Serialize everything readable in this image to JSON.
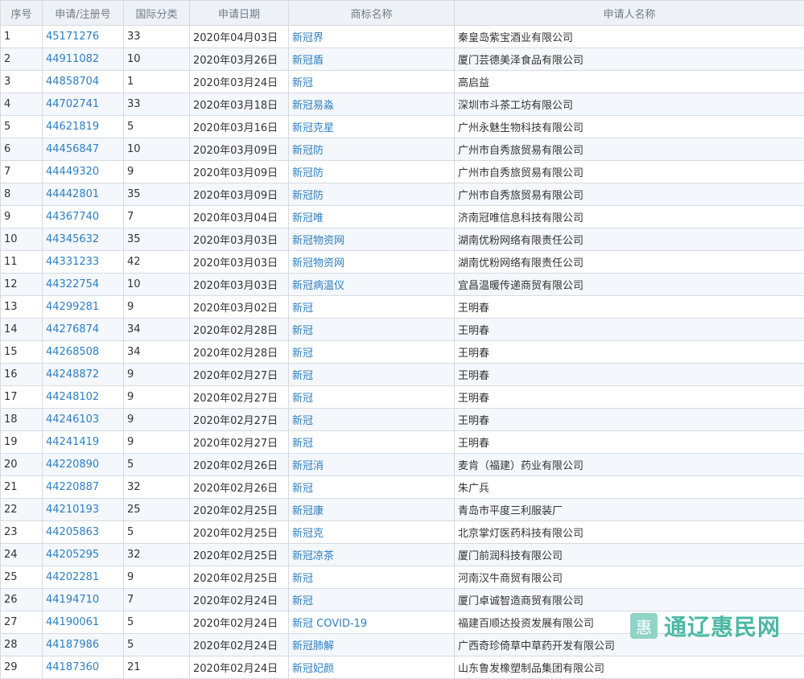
{
  "headers": [
    "序号",
    "申请/注册号",
    "国际分类",
    "申请日期",
    "商标名称",
    "申请人名称"
  ],
  "rows": [
    [
      "1",
      "45171276",
      "33",
      "2020年04月03日",
      "新冠界",
      "秦皇岛紫宝酒业有限公司"
    ],
    [
      "2",
      "44911082",
      "10",
      "2020年03月26日",
      "新冠盾",
      "厦门芸德美泽食品有限公司"
    ],
    [
      "3",
      "44858704",
      "1",
      "2020年03月24日",
      "新冠",
      "高启益"
    ],
    [
      "4",
      "44702741",
      "33",
      "2020年03月18日",
      "新冠易淼",
      "深圳市斗茶工坊有限公司"
    ],
    [
      "5",
      "44621819",
      "5",
      "2020年03月16日",
      "新冠克星",
      "广州永魅生物科技有限公司"
    ],
    [
      "6",
      "44456847",
      "10",
      "2020年03月09日",
      "新冠防",
      "广州市自秀旅贸易有限公司"
    ],
    [
      "7",
      "44449320",
      "9",
      "2020年03月09日",
      "新冠防",
      "广州市自秀旅贸易有限公司"
    ],
    [
      "8",
      "44442801",
      "35",
      "2020年03月09日",
      "新冠防",
      "广州市自秀旅贸易有限公司"
    ],
    [
      "9",
      "44367740",
      "7",
      "2020年03月04日",
      "新冠唯",
      "济南冠唯信息科技有限公司"
    ],
    [
      "10",
      "44345632",
      "35",
      "2020年03月03日",
      "新冠物资网",
      "湖南优粉网络有限责任公司"
    ],
    [
      "11",
      "44331233",
      "42",
      "2020年03月03日",
      "新冠物资网",
      "湖南优粉网络有限责任公司"
    ],
    [
      "12",
      "44322754",
      "10",
      "2020年03月03日",
      "新冠病温仪",
      "宜昌温暖传递商贸有限公司"
    ],
    [
      "13",
      "44299281",
      "9",
      "2020年03月02日",
      "新冠",
      "王明春"
    ],
    [
      "14",
      "44276874",
      "34",
      "2020年02月28日",
      "新冠",
      "王明春"
    ],
    [
      "15",
      "44268508",
      "34",
      "2020年02月28日",
      "新冠",
      "王明春"
    ],
    [
      "16",
      "44248872",
      "9",
      "2020年02月27日",
      "新冠",
      "王明春"
    ],
    [
      "17",
      "44248102",
      "9",
      "2020年02月27日",
      "新冠",
      "王明春"
    ],
    [
      "18",
      "44246103",
      "9",
      "2020年02月27日",
      "新冠",
      "王明春"
    ],
    [
      "19",
      "44241419",
      "9",
      "2020年02月27日",
      "新冠",
      "王明春"
    ],
    [
      "20",
      "44220890",
      "5",
      "2020年02月26日",
      "新冠消",
      "麦肯（福建）药业有限公司"
    ],
    [
      "21",
      "44220887",
      "32",
      "2020年02月26日",
      "新冠",
      "朱广兵"
    ],
    [
      "22",
      "44210193",
      "25",
      "2020年02月25日",
      "新冠康",
      "青岛市平度三利服装厂"
    ],
    [
      "23",
      "44205863",
      "5",
      "2020年02月25日",
      "新冠克",
      "北京掌灯医药科技有限公司"
    ],
    [
      "24",
      "44205295",
      "32",
      "2020年02月25日",
      "新冠凉茶",
      "厦门前润科技有限公司"
    ],
    [
      "25",
      "44202281",
      "9",
      "2020年02月25日",
      "新冠",
      "河南汉牛商贸有限公司"
    ],
    [
      "26",
      "44194710",
      "7",
      "2020年02月24日",
      "新冠",
      "厦门卓诚智造商贸有限公司"
    ],
    [
      "27",
      "44190061",
      "5",
      "2020年02月24日",
      "新冠 COVID-19",
      "福建百顺达投资发展有限公司"
    ],
    [
      "28",
      "44187986",
      "5",
      "2020年02月24日",
      "新冠肺解",
      "广西奇珍倚草中草药开发有限公司"
    ],
    [
      "29",
      "44187360",
      "21",
      "2020年02月24日",
      "新冠妃颜",
      "山东鲁发橡塑制品集团有限公司"
    ]
  ],
  "watermark": {
    "logo_glyph": "惠",
    "text": "通辽惠民网"
  },
  "colors": {
    "link": "#2d7fc1",
    "header_bg": "#eef1f5",
    "stripe": "#f4f7fb",
    "border": "#d6dbe1",
    "watermark": "#4bb8a3"
  }
}
